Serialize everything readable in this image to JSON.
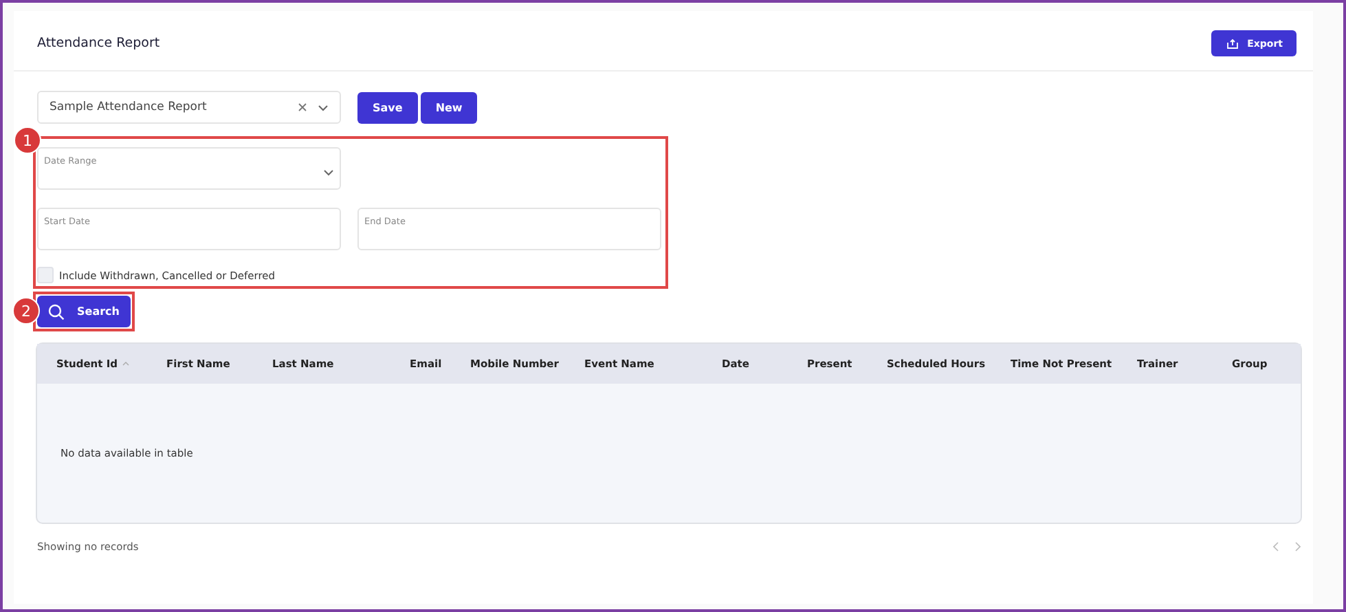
{
  "header": {
    "title": "Attendance Report",
    "export_button": "Export"
  },
  "report_select": {
    "value": "Sample Attendance Report"
  },
  "buttons": [
    "Save",
    "New"
  ],
  "callouts": [
    "1",
    "2"
  ],
  "filters": {
    "date_range": {
      "placeholder": "Date Range"
    },
    "start_date": {
      "placeholder": "Start Date"
    },
    "end_date": {
      "placeholder": "End Date"
    },
    "include_checkbox": {
      "label": "Include Withdrawn, Cancelled or Deferred",
      "checked": false
    }
  },
  "search_button": "Search",
  "table": {
    "columns": [
      {
        "label": "Student Id",
        "sorted": true
      },
      {
        "label": "First Name",
        "sorted": false
      },
      {
        "label": "Last Name",
        "sorted": false
      },
      {
        "label": "Email",
        "sorted": false
      },
      {
        "label": "Mobile Number",
        "sorted": false
      },
      {
        "label": "Event Name",
        "sorted": false
      },
      {
        "label": "Date",
        "sorted": false
      },
      {
        "label": "Present",
        "sorted": false
      },
      {
        "label": "Scheduled Hours",
        "sorted": false
      },
      {
        "label": "Time Not Present",
        "sorted": false
      },
      {
        "label": "Trainer",
        "sorted": false
      },
      {
        "label": "Group",
        "sorted": false
      }
    ],
    "empty_message": "No data available in table"
  },
  "status_bar": {
    "info": "Showing no records"
  }
}
